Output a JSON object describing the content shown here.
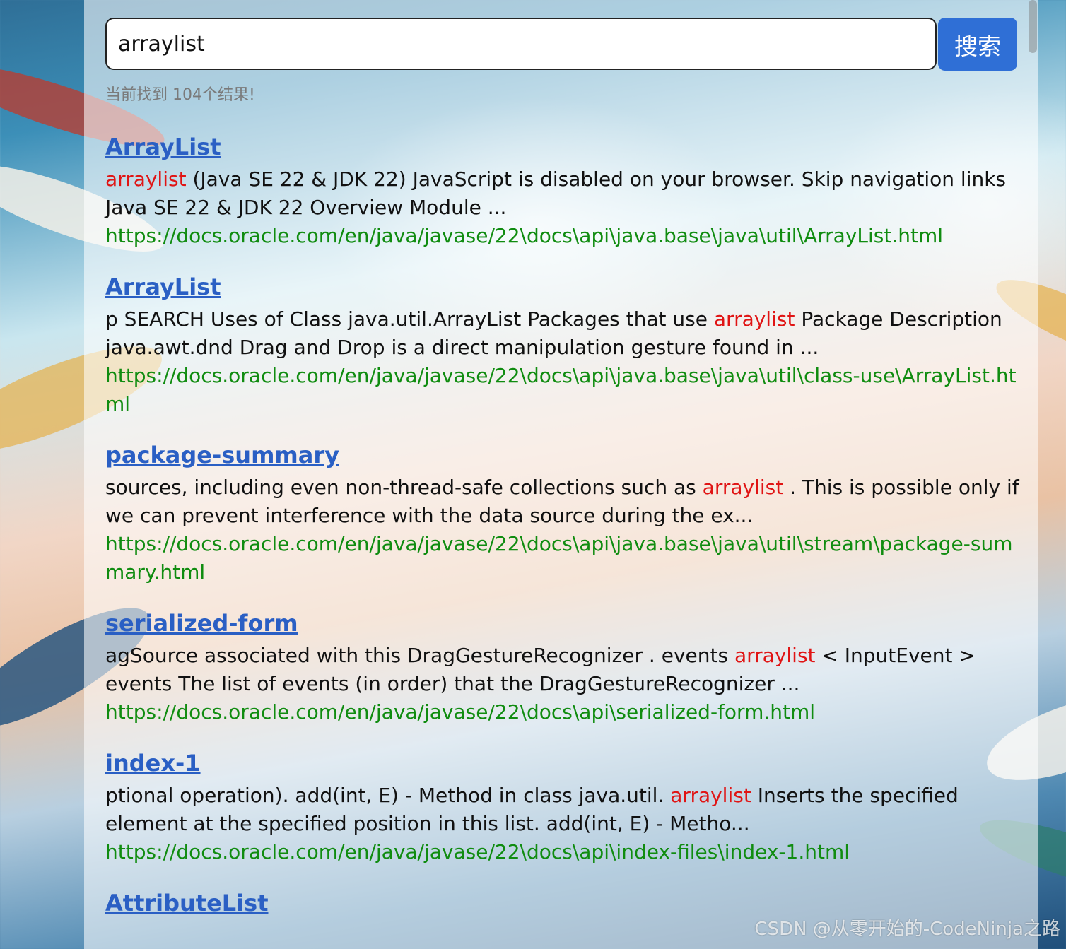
{
  "search": {
    "value": "arraylist",
    "button_label": "搜索"
  },
  "result_count": "当前找到 104个结果!",
  "results": [
    {
      "title": "ArrayList",
      "desc_before": "",
      "desc_highlight": "arraylist",
      "desc_after": " (Java SE 22 & JDK 22) JavaScript is disabled on your browser.       Skip navigation links Java SE 22 & JDK 22 Overview Module ...",
      "url": "https://docs.oracle.com/en/java/javase/22\\docs\\api\\java.base\\java\\util\\ArrayList.html"
    },
    {
      "title": "ArrayList",
      "desc_before": "p SEARCH Uses of Class java.util.ArrayList Packages that use ",
      "desc_highlight": "arraylist",
      "desc_after": " Package Description java.awt.dnd Drag and Drop is a direct manipulation gesture found in ...",
      "url": "https://docs.oracle.com/en/java/javase/22\\docs\\api\\java.base\\java\\util\\class-use\\ArrayList.html"
    },
    {
      "title": "package-summary",
      "desc_before": "sources, including even non-thread-safe collections such as ",
      "desc_highlight": "arraylist",
      "desc_after": " . This is possible only if we can prevent interference with the data source during the ex...",
      "url": "https://docs.oracle.com/en/java/javase/22\\docs\\api\\java.base\\java\\util\\stream\\package-summary.html"
    },
    {
      "title": "serialized-form",
      "desc_before": "agSource associated with this DragGestureRecognizer . events ",
      "desc_highlight": "arraylist",
      "desc_after": " < InputEvent > events The list of events (in order) that the DragGestureRecognizer ...",
      "url": "https://docs.oracle.com/en/java/javase/22\\docs\\api\\serialized-form.html"
    },
    {
      "title": "index-1",
      "desc_before": "ptional operation). add(int, E) - Method in class java.util. ",
      "desc_highlight": "arraylist",
      "desc_after": " Inserts the specified element at the specified position in this list. add(int, E) - Metho...",
      "url": "https://docs.oracle.com/en/java/javase/22\\docs\\api\\index-files\\index-1.html"
    },
    {
      "title": "AttributeList",
      "desc_before": "",
      "desc_highlight": "",
      "desc_after": "",
      "url": ""
    }
  ],
  "watermark": "CSDN @从零开始的-CodeNinja之路"
}
